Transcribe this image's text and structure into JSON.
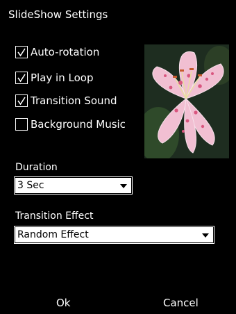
{
  "dialog": {
    "title": "SlideShow Settings"
  },
  "options": [
    {
      "label": "Auto-rotation",
      "checked": true
    },
    {
      "label": "Play in Loop",
      "checked": true
    },
    {
      "label": "Transition Sound",
      "checked": true
    },
    {
      "label": "Background Music",
      "checked": false
    }
  ],
  "duration": {
    "label": "Duration",
    "value": "3 Sec"
  },
  "transition": {
    "label": "Transition Effect",
    "value": "Random Effect"
  },
  "softkeys": {
    "left": "Ok",
    "right": "Cancel"
  },
  "preview": {
    "icon": "lily-flower-photo"
  }
}
